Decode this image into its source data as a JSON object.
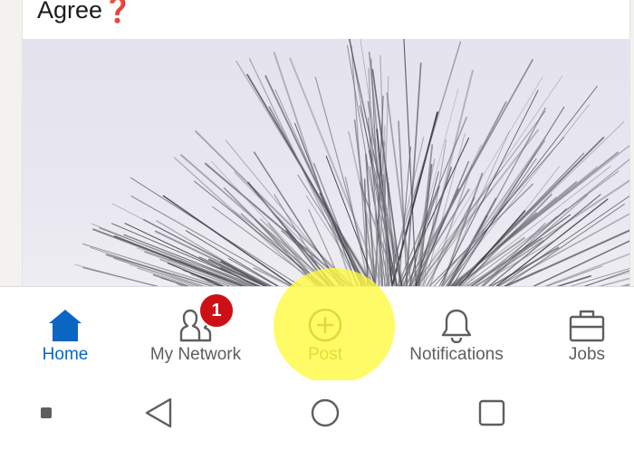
{
  "post": {
    "text": "Agree",
    "emoji": "❓"
  },
  "bottom_nav": {
    "items": [
      {
        "label": "Home",
        "icon": "home-icon",
        "active": true
      },
      {
        "label": "My Network",
        "icon": "my-network-icon",
        "badge": "1"
      },
      {
        "label": "Post",
        "icon": "add-circle-icon"
      },
      {
        "label": "Notifications",
        "icon": "bell-icon"
      },
      {
        "label": "Jobs",
        "icon": "briefcase-icon"
      }
    ]
  },
  "system_nav": {
    "buttons": [
      "recents-dot",
      "back-icon",
      "home-circle-icon",
      "overview-square-icon"
    ]
  },
  "colors": {
    "active": "#0a66c2",
    "inactive": "#5e5e5e",
    "badge": "#cc1016",
    "highlight": "#fffa3c"
  }
}
